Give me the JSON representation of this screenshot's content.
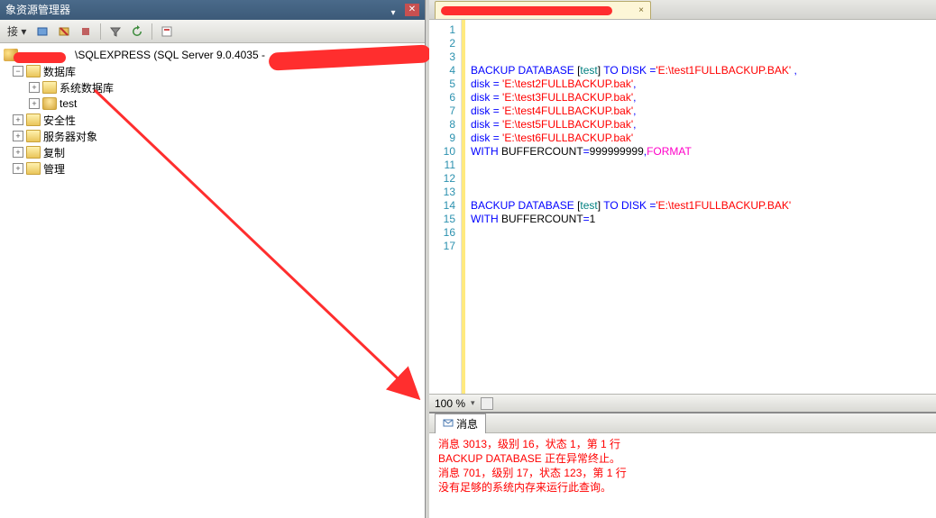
{
  "explorer": {
    "title": "象资源管理器",
    "connect_label": "接 ▾",
    "server_text": "\\SQLEXPRESS (SQL Server 9.0.4035 - ",
    "nodes": {
      "databases": "数据库",
      "system_db": "系统数据库",
      "test_db": "test",
      "security": "安全性",
      "server_objects": "服务器对象",
      "replication": "复制",
      "management": "管理"
    }
  },
  "tab": {
    "close": "×"
  },
  "zoom": {
    "value": "100 %",
    "dropdown": "▾"
  },
  "code": {
    "lines": [
      {
        "num": 1,
        "segs": []
      },
      {
        "num": 2,
        "segs": []
      },
      {
        "num": 3,
        "segs": []
      },
      {
        "num": 4,
        "segs": [
          {
            "t": "BACKUP",
            "c": "kw"
          },
          {
            "t": " "
          },
          {
            "t": "DATABASE",
            "c": "kw"
          },
          {
            "t": " ["
          },
          {
            "t": "test",
            "c": "obj"
          },
          {
            "t": "] "
          },
          {
            "t": "TO",
            "c": "kw"
          },
          {
            "t": " "
          },
          {
            "t": "DISK",
            "c": "kw"
          },
          {
            "t": " "
          },
          {
            "t": "=",
            "c": "br"
          },
          {
            "t": "'E:\\test1FULLBACKUP.BAK'",
            "c": "str"
          },
          {
            "t": " ,",
            "c": "br"
          }
        ]
      },
      {
        "num": 5,
        "segs": [
          {
            "t": "disk",
            "c": "kw"
          },
          {
            "t": " "
          },
          {
            "t": "=",
            "c": "br"
          },
          {
            "t": " "
          },
          {
            "t": "'E:\\test2FULLBACKUP.bak'",
            "c": "str"
          },
          {
            "t": ",",
            "c": "br"
          }
        ]
      },
      {
        "num": 6,
        "segs": [
          {
            "t": "disk",
            "c": "kw"
          },
          {
            "t": " "
          },
          {
            "t": "=",
            "c": "br"
          },
          {
            "t": " "
          },
          {
            "t": "'E:\\test3FULLBACKUP.bak'",
            "c": "str"
          },
          {
            "t": ",",
            "c": "br"
          }
        ]
      },
      {
        "num": 7,
        "segs": [
          {
            "t": "disk",
            "c": "kw"
          },
          {
            "t": " "
          },
          {
            "t": "=",
            "c": "br"
          },
          {
            "t": " "
          },
          {
            "t": "'E:\\test4FULLBACKUP.bak'",
            "c": "str"
          },
          {
            "t": ",",
            "c": "br"
          }
        ]
      },
      {
        "num": 8,
        "segs": [
          {
            "t": "disk",
            "c": "kw"
          },
          {
            "t": " "
          },
          {
            "t": "=",
            "c": "br"
          },
          {
            "t": " "
          },
          {
            "t": "'E:\\test5FULLBACKUP.bak'",
            "c": "str"
          },
          {
            "t": ",",
            "c": "br"
          }
        ]
      },
      {
        "num": 9,
        "segs": [
          {
            "t": "disk",
            "c": "kw"
          },
          {
            "t": " "
          },
          {
            "t": "=",
            "c": "br"
          },
          {
            "t": " "
          },
          {
            "t": "'E:\\test6FULLBACKUP.bak'",
            "c": "str"
          }
        ]
      },
      {
        "num": 10,
        "segs": [
          {
            "t": "WITH",
            "c": "kw"
          },
          {
            "t": " BUFFERCOUNT"
          },
          {
            "t": "=",
            "c": "br"
          },
          {
            "t": "999999999"
          },
          {
            "t": ",",
            "c": "br"
          },
          {
            "t": "FORMAT",
            "c": "fmt"
          }
        ]
      },
      {
        "num": 11,
        "segs": []
      },
      {
        "num": 12,
        "segs": []
      },
      {
        "num": 13,
        "segs": []
      },
      {
        "num": 14,
        "segs": [
          {
            "t": "BACKUP",
            "c": "kw"
          },
          {
            "t": " "
          },
          {
            "t": "DATABASE",
            "c": "kw"
          },
          {
            "t": " ["
          },
          {
            "t": "test",
            "c": "obj"
          },
          {
            "t": "] "
          },
          {
            "t": "TO",
            "c": "kw"
          },
          {
            "t": " "
          },
          {
            "t": "DISK",
            "c": "kw"
          },
          {
            "t": " "
          },
          {
            "t": "=",
            "c": "br"
          },
          {
            "t": "'E:\\test1FULLBACKUP.BAK'",
            "c": "str"
          }
        ]
      },
      {
        "num": 15,
        "segs": [
          {
            "t": "WITH",
            "c": "kw"
          },
          {
            "t": " BUFFERCOUNT"
          },
          {
            "t": "=",
            "c": "br"
          },
          {
            "t": "1"
          }
        ]
      },
      {
        "num": 16,
        "segs": []
      },
      {
        "num": 17,
        "segs": []
      }
    ]
  },
  "messages": {
    "tab_label": "消息",
    "lines": [
      "消息 3013，级别 16，状态 1，第 1 行",
      "BACKUP DATABASE 正在异常终止。",
      "消息 701，级别 17，状态 123，第 1 行",
      "没有足够的系统内存来运行此查询。"
    ]
  }
}
